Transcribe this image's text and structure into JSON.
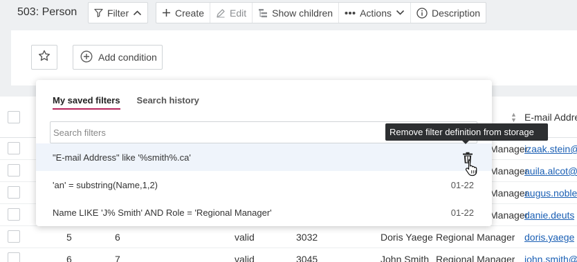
{
  "toolbar": {
    "title": "503: Person",
    "filter_label": "Filter",
    "create_label": "Create",
    "edit_label": "Edit",
    "show_children_label": "Show children",
    "actions_label": "Actions",
    "description_label": "Description"
  },
  "filter_bar": {
    "add_condition_label": "Add condition"
  },
  "table": {
    "email_header": "E-mail Addres",
    "rows": [
      {
        "c1": "",
        "c2": "",
        "status": "",
        "num": "",
        "name": "",
        "role": "Manager",
        "email": "izaak.stein@"
      },
      {
        "c1": "",
        "c2": "",
        "status": "",
        "num": "",
        "name": "",
        "role": "Manager",
        "email": "auila.alcot@"
      },
      {
        "c1": "",
        "c2": "",
        "status": "",
        "num": "",
        "name": "",
        "role": "Manager",
        "email": "augus.noble"
      },
      {
        "c1": "",
        "c2": "",
        "status": "",
        "num": "",
        "name": "",
        "role": "Manager",
        "email": "danie.deuts"
      },
      {
        "c1": "5",
        "c2": "6",
        "status": "valid",
        "num": "3032",
        "name": "Doris Yaege",
        "role": "Regional Manager",
        "email": "doris.yaege"
      },
      {
        "c1": "6",
        "c2": "7",
        "status": "valid",
        "num": "3045",
        "name": "John Smith",
        "role": "Regional Manager",
        "email": "john.smith@"
      }
    ]
  },
  "dropdown": {
    "tabs": [
      "My saved filters",
      "Search history"
    ],
    "search_placeholder": "Search filters",
    "items": [
      {
        "query": "\"E-mail Address\" like '%smith%.ca'",
        "date": ""
      },
      {
        "query": "'an' = substring(Name,1,2)",
        "date": "01-22"
      },
      {
        "query": "Name LIKE 'J% Smith' AND Role = 'Regional Manager'",
        "date": "01-22"
      }
    ]
  },
  "tooltip": {
    "text": "Remove filter definition from storage"
  },
  "colors": {
    "accent": "#b6245b",
    "link": "#1a5fb4",
    "tooltip_bg": "#2d2f31",
    "hover_row": "#eff4fb"
  }
}
